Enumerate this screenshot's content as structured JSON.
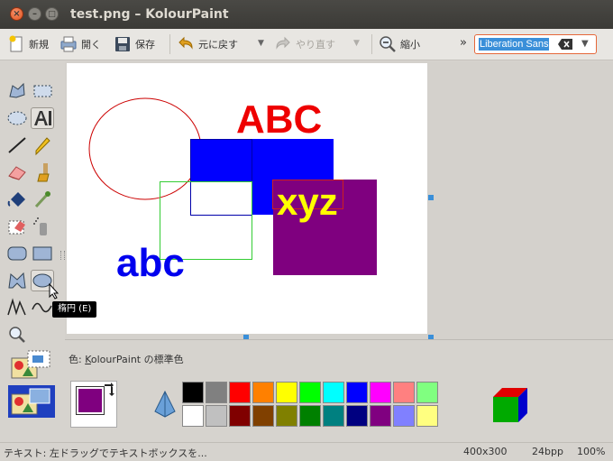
{
  "window": {
    "title": "test.png – KolourPaint",
    "close_glyph": "×",
    "min_glyph": "–",
    "max_glyph": "□"
  },
  "toolbar": {
    "new_label": "新規",
    "open_label": "開く",
    "save_label": "保存",
    "undo_label": "元に戻す",
    "redo_label": "やり直す",
    "zoom_out_label": "縮小",
    "overflow_glyph": "»",
    "dropdown_glyph": "▼",
    "font_value": "Liberation Sans"
  },
  "canvas": {
    "text_abc_upper": "ABC",
    "text_xyz": "xyz",
    "text_abc_lower": "abc"
  },
  "tooltip": {
    "text": "楕円 (E)"
  },
  "colors": {
    "label_prefix": "色: ",
    "label_mnemonic": "K",
    "label_rest": "olourPaint の標準色",
    "foreground": "#7f007f",
    "background": "#ffffff",
    "swatches_row1": [
      "#000000",
      "#808080",
      "#ff0000",
      "#ff8000",
      "#ffff00",
      "#00ff00",
      "#00ffff",
      "#0000ff",
      "#ff00ff",
      "#ff8080",
      "#80ff80"
    ],
    "swatches_row2": [
      "#ffffff",
      "#c0c0c0",
      "#800000",
      "#804000",
      "#808000",
      "#008000",
      "#008080",
      "#000080",
      "#800080",
      "#8080ff",
      "#ffff80"
    ]
  },
  "status": {
    "message": "テキスト: 左ドラッグでテキストボックスを...",
    "dimensions": "400x300",
    "depth": "24bpp",
    "zoom": "100%"
  }
}
